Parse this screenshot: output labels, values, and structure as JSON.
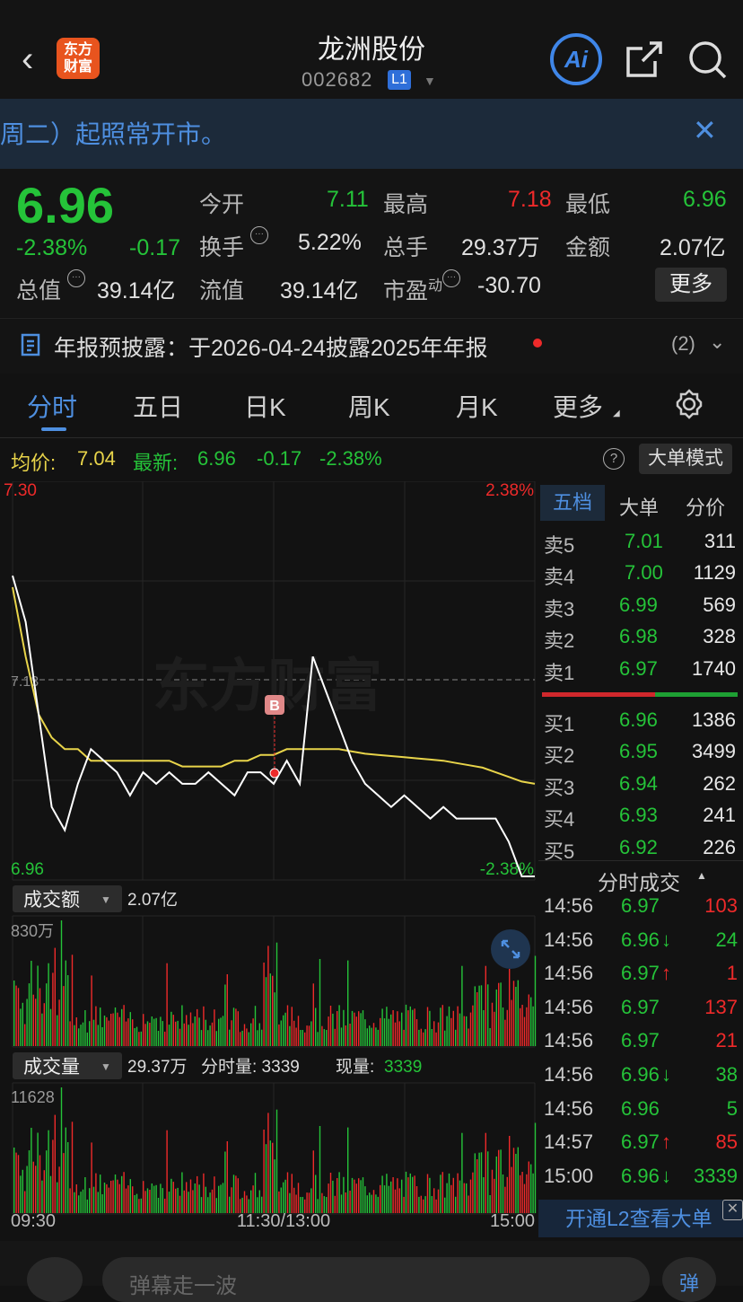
{
  "header": {
    "logo_line1": "东方",
    "logo_line2": "财富",
    "title": "龙洲股份",
    "code": "002682",
    "level": "L1",
    "ai": "Ai"
  },
  "notice": {
    "text": "周二）起照常开市。"
  },
  "quote": {
    "price": "6.96",
    "change_pct": "-2.38%",
    "change": "-0.17",
    "open_label": "今开",
    "open": "7.11",
    "high_label": "最高",
    "high": "7.18",
    "low_label": "最低",
    "low": "6.96",
    "turnover_label": "换手",
    "turnover": "5.22%",
    "volume_label": "总手",
    "volume": "29.37万",
    "amount_label": "金额",
    "amount": "2.07亿",
    "mcap_label": "总值",
    "mcap": "39.14亿",
    "float_label": "流值",
    "float_cap": "39.14亿",
    "pe_label": "市盈",
    "pe_sup": "动",
    "pe": "-30.70",
    "more": "更多"
  },
  "annual": {
    "text": "年报预披露：于2026-04-24披露2025年年报",
    "count": "(2)"
  },
  "tabs": [
    "分时",
    "五日",
    "日K",
    "周K",
    "月K",
    "更多"
  ],
  "status": {
    "avg_label": "均价:",
    "avg": "7.04",
    "last_label": "最新:",
    "last": "6.96",
    "chg": "-0.17",
    "pct": "-2.38%",
    "mode": "大单模式",
    "help": "?"
  },
  "chart_axis": {
    "top": "7.30",
    "top_pct": "2.38%",
    "mid": "7.13",
    "bottom": "6.96",
    "bottom_pct": "-2.38%",
    "marker": "B"
  },
  "amount_panel": {
    "label": "成交额",
    "value": "2.07亿",
    "max": "830万"
  },
  "volume_panel": {
    "label": "成交量",
    "value": "29.37万",
    "tick": "分时量: 3339",
    "now_label": "现量:",
    "now": "3339",
    "max": "11628"
  },
  "time_axis": {
    "start": "09:30",
    "mid": "11:30/13:00",
    "end": "15:00"
  },
  "orderbook": {
    "tabs": [
      "五档",
      "大单",
      "分价"
    ],
    "asks": [
      {
        "label": "卖5",
        "price": "7.01",
        "vol": "311"
      },
      {
        "label": "卖4",
        "price": "7.00",
        "vol": "1129"
      },
      {
        "label": "卖3",
        "price": "6.99",
        "vol": "569"
      },
      {
        "label": "卖2",
        "price": "6.98",
        "vol": "328"
      },
      {
        "label": "卖1",
        "price": "6.97",
        "vol": "1740"
      }
    ],
    "bids": [
      {
        "label": "买1",
        "price": "6.96",
        "vol": "1386"
      },
      {
        "label": "买2",
        "price": "6.95",
        "vol": "3499"
      },
      {
        "label": "买3",
        "price": "6.94",
        "vol": "262"
      },
      {
        "label": "买4",
        "price": "6.93",
        "vol": "241"
      },
      {
        "label": "买5",
        "price": "6.92",
        "vol": "226"
      }
    ]
  },
  "trades": {
    "title": "分时成交",
    "rows": [
      {
        "t": "14:56",
        "p": "6.97",
        "a": "",
        "v": "103",
        "c": "r"
      },
      {
        "t": "14:56",
        "p": "6.96",
        "a": "↓",
        "v": "24",
        "c": "g"
      },
      {
        "t": "14:56",
        "p": "6.97",
        "a": "↑",
        "v": "1",
        "c": "r"
      },
      {
        "t": "14:56",
        "p": "6.97",
        "a": "",
        "v": "137",
        "c": "r"
      },
      {
        "t": "14:56",
        "p": "6.97",
        "a": "",
        "v": "21",
        "c": "r"
      },
      {
        "t": "14:56",
        "p": "6.96",
        "a": "↓",
        "v": "38",
        "c": "g"
      },
      {
        "t": "14:56",
        "p": "6.96",
        "a": "",
        "v": "5",
        "c": "g"
      },
      {
        "t": "14:57",
        "p": "6.97",
        "a": "↑",
        "v": "85",
        "c": "r"
      },
      {
        "t": "15:00",
        "p": "6.96",
        "a": "↓",
        "v": "3339",
        "c": "g"
      }
    ]
  },
  "l2": "开通L2查看大单",
  "bottom": {
    "placeholder": "弹幕走一波",
    "btn": "弹"
  },
  "colors": {
    "up": "#ee2a2a",
    "down": "#25c339",
    "accent": "#4e8fe0",
    "avg_line": "#e8d44a"
  },
  "chart_data": {
    "type": "line",
    "xlabel": "",
    "ylabel": "",
    "ylim": [
      6.96,
      7.3
    ],
    "prev_close": 7.13,
    "x": [
      "09:30",
      "11:30/13:00",
      "15:00"
    ],
    "series": [
      {
        "values": [
          7.22,
          7.18,
          7.1,
          7.02,
          7.0,
          7.04,
          7.07,
          7.06,
          7.05,
          7.03,
          7.05,
          7.04,
          7.05,
          7.04,
          7.04,
          7.05,
          7.04,
          7.03,
          7.05,
          7.05,
          7.04,
          7.06,
          7.04,
          7.15,
          7.12,
          7.09,
          7.06,
          7.04,
          7.03,
          7.02,
          7.03,
          7.02,
          7.01,
          7.02,
          7.01,
          7.01,
          7.01,
          7.01,
          6.99,
          6.96,
          6.96
        ]
      },
      {
        "values": [
          7.21,
          7.15,
          7.1,
          7.08,
          7.07,
          7.07,
          7.06,
          7.06,
          7.06,
          7.06,
          7.06,
          7.06,
          7.06,
          7.055,
          7.055,
          7.055,
          7.055,
          7.06,
          7.06,
          7.065,
          7.065,
          7.07,
          7.07,
          7.07,
          7.07,
          7.07,
          7.068,
          7.066,
          7.065,
          7.064,
          7.063,
          7.062,
          7.061,
          7.06,
          7.058,
          7.056,
          7.054,
          7.05,
          7.046,
          7.042,
          7.04
        ]
      }
    ]
  }
}
